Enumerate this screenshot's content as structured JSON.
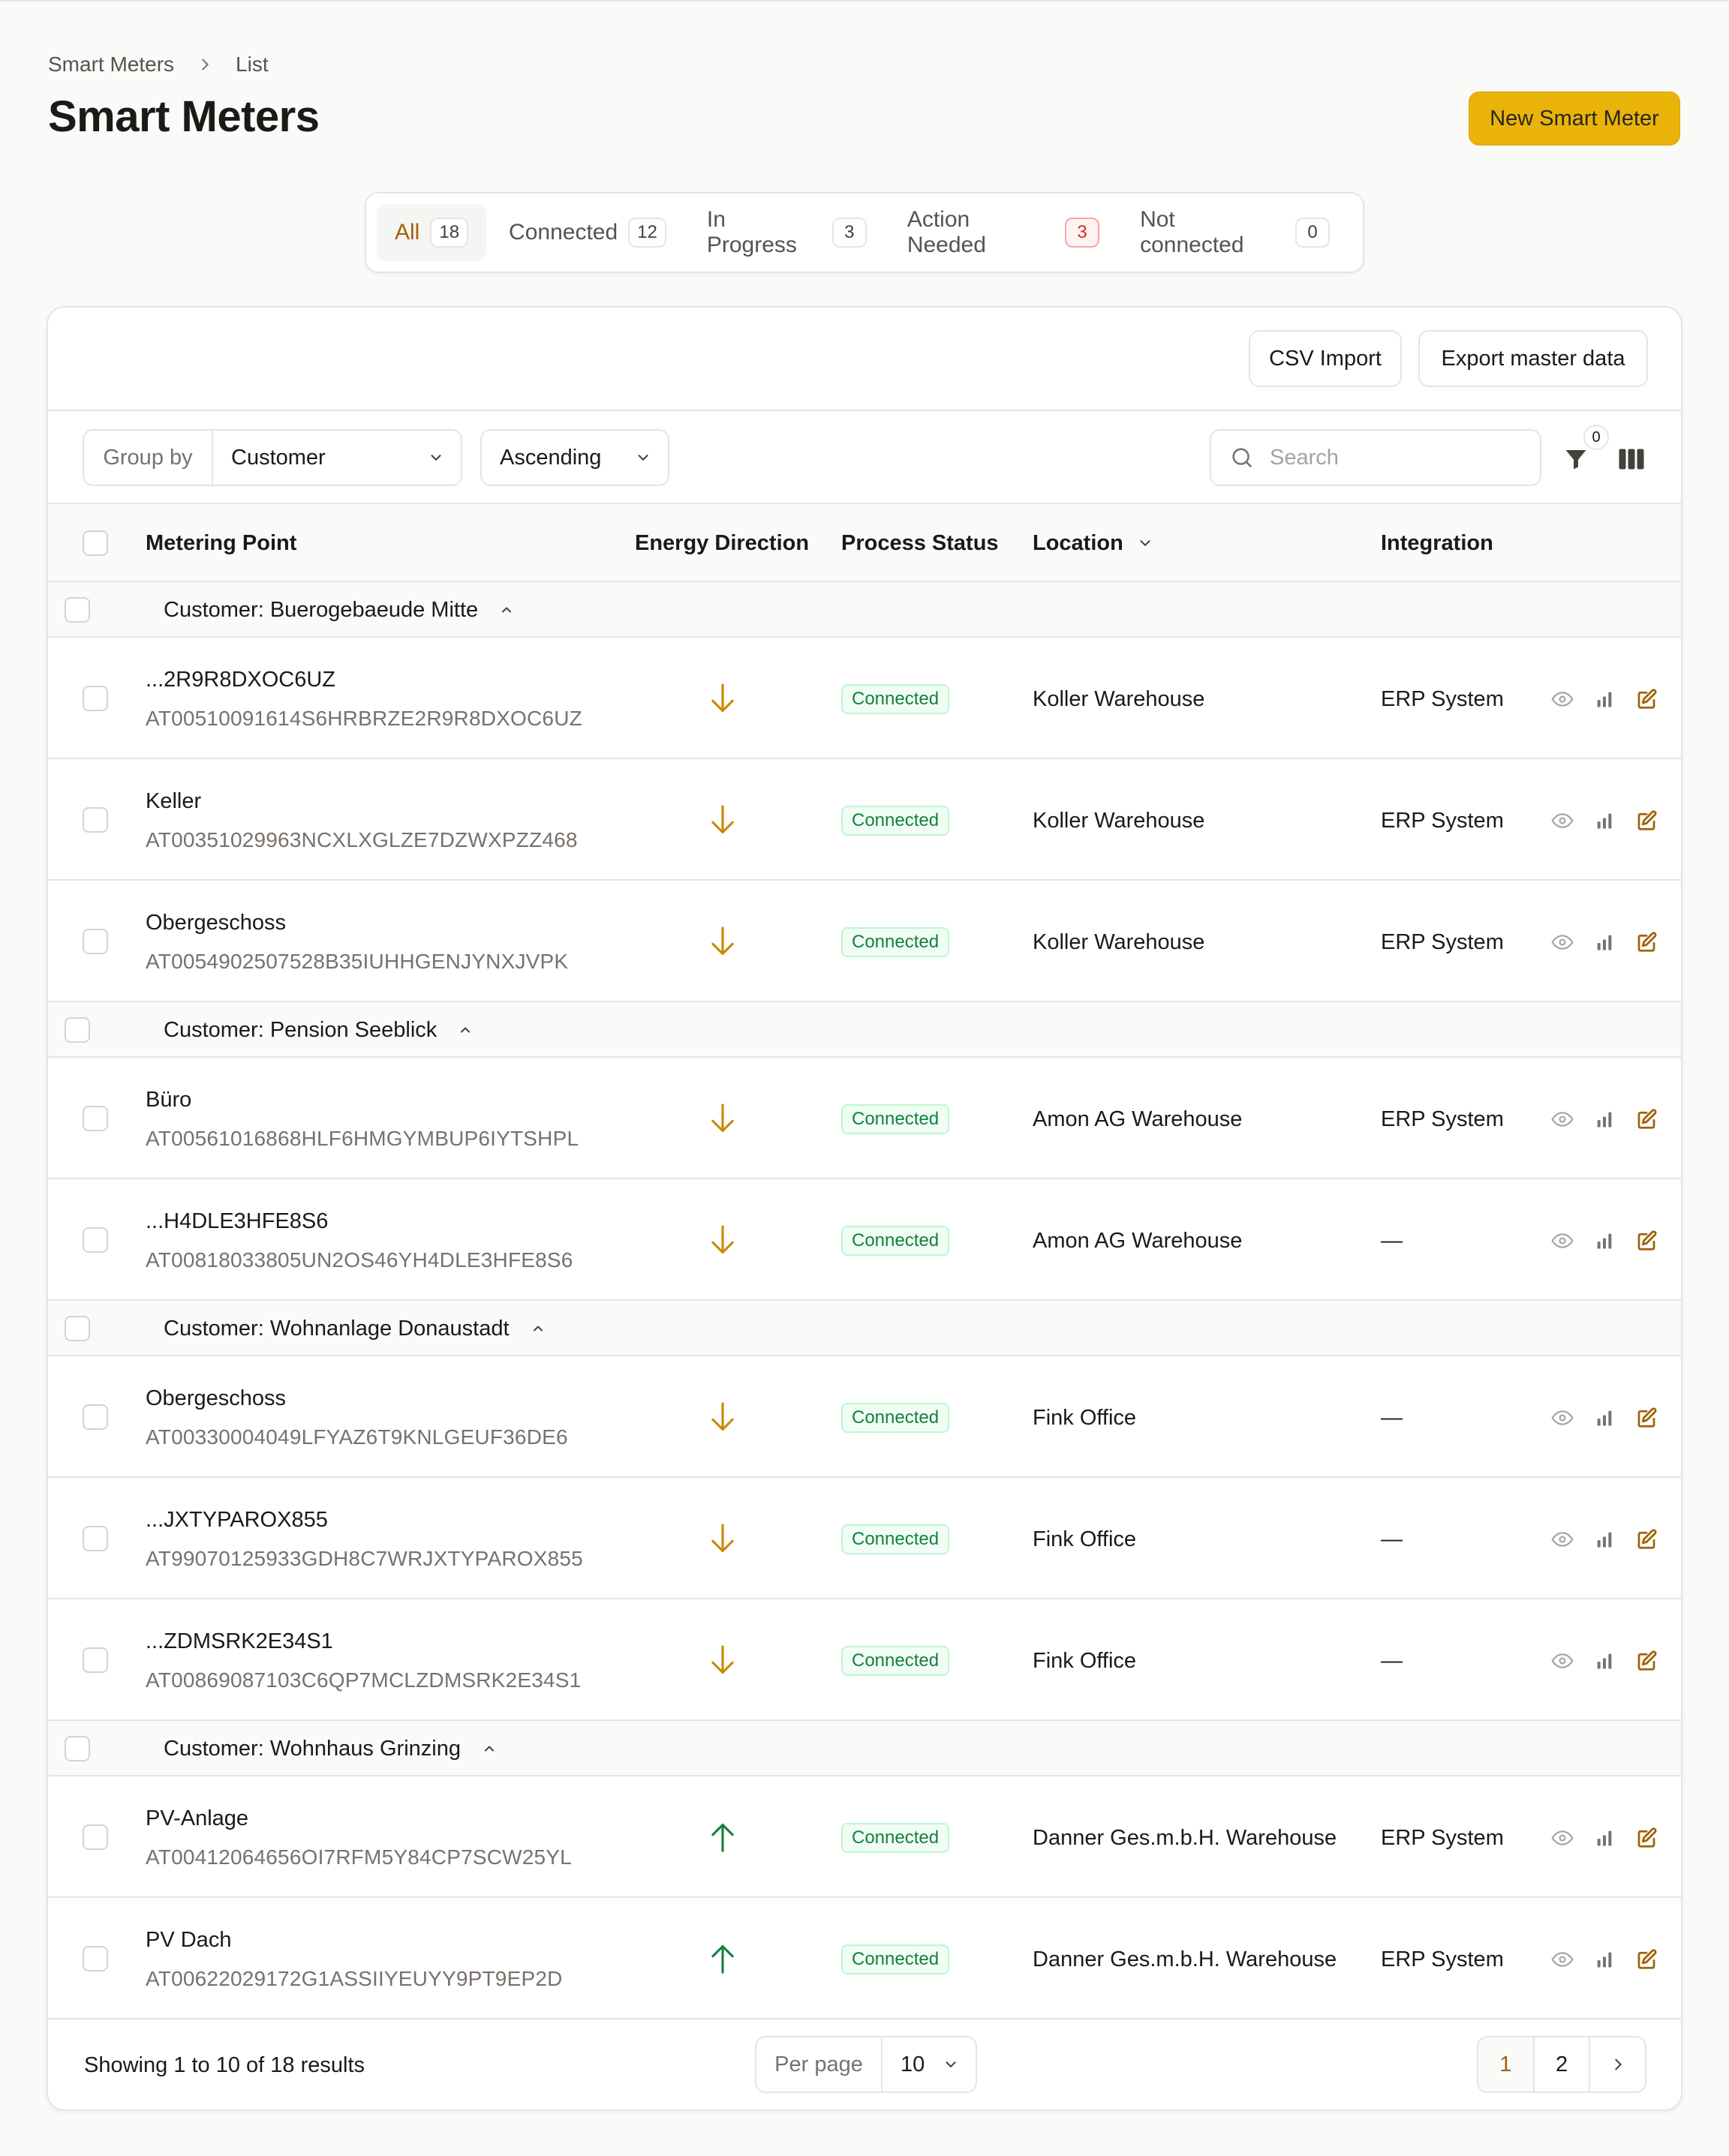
{
  "breadcrumb": {
    "root": "Smart Meters",
    "current": "List"
  },
  "page_title": "Smart Meters",
  "new_button": "New Smart Meter",
  "tabs": [
    {
      "label": "All",
      "count": "18"
    },
    {
      "label": "Connected",
      "count": "12"
    },
    {
      "label": "In Progress",
      "count": "3"
    },
    {
      "label": "Action Needed",
      "count": "3"
    },
    {
      "label": "Not connected",
      "count": "0"
    }
  ],
  "actions": {
    "csv_import": "CSV Import",
    "export": "Export master data"
  },
  "toolbar": {
    "group_by_label": "Group by",
    "group_by_value": "Customer",
    "order_value": "Ascending",
    "search_placeholder": "Search",
    "filter_count": "0"
  },
  "columns": {
    "metering_point": "Metering Point",
    "energy_direction": "Energy Direction",
    "process_status": "Process Status",
    "location": "Location",
    "integration": "Integration"
  },
  "groups": [
    {
      "label": "Customer: Buerogebaeude Mitte"
    },
    {
      "label": "Customer: Pension Seeblick"
    },
    {
      "label": "Customer: Wohnanlage Donaustadt"
    },
    {
      "label": "Customer: Wohnhaus Grinzing"
    }
  ],
  "rows": [
    {
      "name": "...2R9R8DXOC6UZ",
      "id": "AT00510091614S6HRBRZE2R9R8DXOC6UZ",
      "direction": "consumption",
      "status": "Connected",
      "location": "Koller Warehouse",
      "integration": "ERP System"
    },
    {
      "name": "Keller",
      "id": "AT00351029963NCXLXGLZE7DZWXPZZ468",
      "direction": "consumption",
      "status": "Connected",
      "location": "Koller Warehouse",
      "integration": "ERP System"
    },
    {
      "name": "Obergeschoss",
      "id": "AT0054902507528B35IUHHGENJYNXJVPK",
      "direction": "consumption",
      "status": "Connected",
      "location": "Koller Warehouse",
      "integration": "ERP System"
    },
    {
      "name": "Büro",
      "id": "AT00561016868HLF6HMGYMBUP6IYTSHPL",
      "direction": "consumption",
      "status": "Connected",
      "location": "Amon AG Warehouse",
      "integration": "ERP System"
    },
    {
      "name": "...H4DLE3HFE8S6",
      "id": "AT00818033805UN2OS46YH4DLE3HFE8S6",
      "direction": "consumption",
      "status": "Connected",
      "location": "Amon AG Warehouse",
      "integration": "—"
    },
    {
      "name": "Obergeschoss",
      "id": "AT00330004049LFYAZ6T9KNLGEUF36DE6",
      "direction": "consumption",
      "status": "Connected",
      "location": "Fink Office",
      "integration": "—"
    },
    {
      "name": "...JXTYPAROX855",
      "id": "AT99070125933GDH8C7WRJXTYPAROX855",
      "direction": "consumption",
      "status": "Connected",
      "location": "Fink Office",
      "integration": "—"
    },
    {
      "name": "...ZDMSRK2E34S1",
      "id": "AT00869087103C6QP7MCLZDMSRK2E34S1",
      "direction": "consumption",
      "status": "Connected",
      "location": "Fink Office",
      "integration": "—"
    },
    {
      "name": "PV-Anlage",
      "id": "AT00412064656OI7RFM5Y84CP7SCW25YL",
      "direction": "production",
      "status": "Connected",
      "location": "Danner Ges.m.b.H. Warehouse",
      "integration": "ERP System"
    },
    {
      "name": "PV Dach",
      "id": "AT00622029172G1ASSIIYEUYY9PT9EP2D",
      "direction": "production",
      "status": "Connected",
      "location": "Danner Ges.m.b.H. Warehouse",
      "integration": "ERP System"
    }
  ],
  "footer": {
    "showing": "Showing 1 to 10 of 18 results",
    "per_page_label": "Per page",
    "per_page_value": "10",
    "pages": [
      "1",
      "2"
    ]
  },
  "colors": {
    "accent": "#eab308",
    "consumption_arrow": "#ca8a04",
    "production_arrow": "#15803d",
    "status_connected": "#15803d",
    "danger": "#dc2626"
  },
  "icons": {
    "breadcrumb_separator": "chevron-right-icon",
    "consumption": "arrow-down-icon",
    "production": "arrow-up-icon",
    "view": "eye-icon",
    "chart": "bar-chart-icon",
    "edit": "edit-icon",
    "filter": "funnel-icon",
    "columns": "columns-icon",
    "search": "search-icon"
  }
}
